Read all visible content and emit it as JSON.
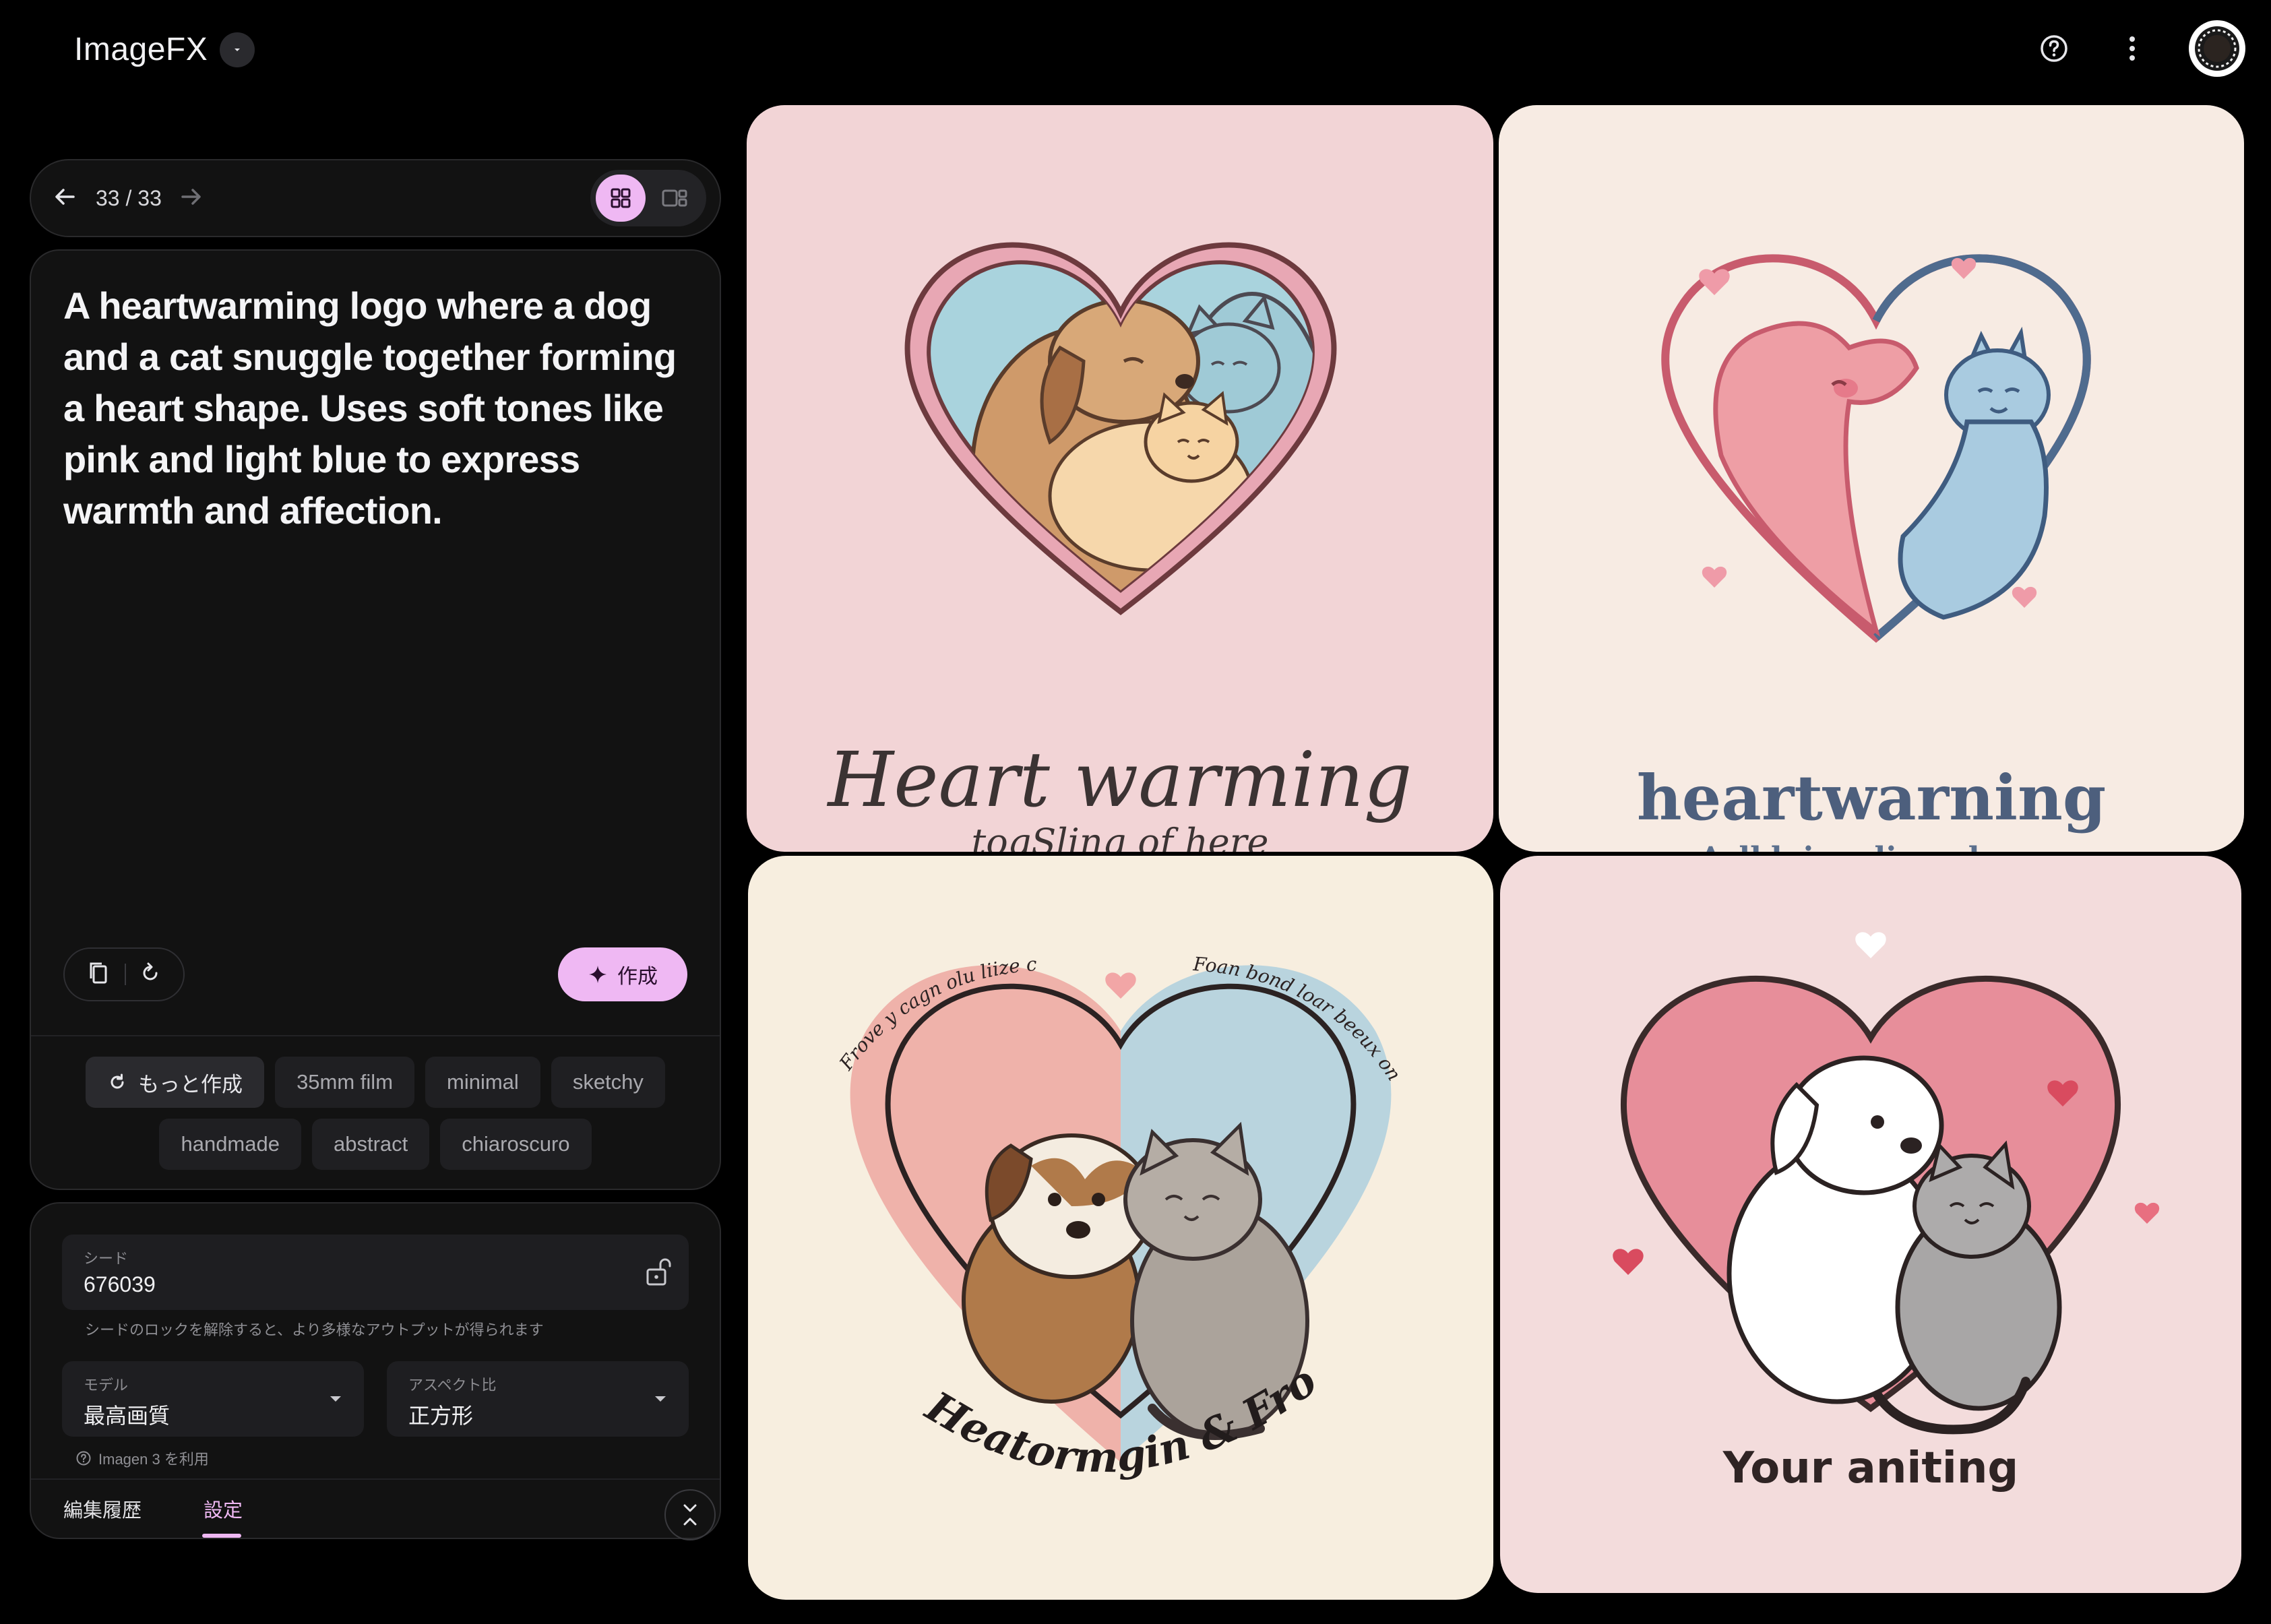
{
  "app": {
    "name": "ImageFX"
  },
  "header": {
    "icons": [
      "help-icon",
      "more-vert-icon",
      "account-avatar"
    ]
  },
  "navigation": {
    "counter": "33 / 33",
    "view_modes": [
      "grid",
      "single"
    ],
    "active_view": "grid"
  },
  "prompt": {
    "text": "A heartwarming logo where a dog and a cat snuggle together forming a heart shape. Uses soft tones like pink and light blue to express warmth and affection.",
    "create_label": "作成"
  },
  "chips": {
    "more_label": "もっと作成",
    "items": [
      "35mm film",
      "minimal",
      "sketchy",
      "handmade",
      "abstract",
      "chiaroscuro"
    ]
  },
  "settings": {
    "seed": {
      "label": "シード",
      "value": "676039",
      "hint": "シードのロックを解除すると、より多様なアウトプットが得られます"
    },
    "model": {
      "label": "モデル",
      "value": "最高画質",
      "note": "Imagen 3 を利用"
    },
    "aspect": {
      "label": "アスペクト比",
      "value": "正方形"
    },
    "tabs": {
      "history": "編集履歴",
      "settings": "設定"
    }
  },
  "images": [
    {
      "title": "Heart warming",
      "subtitle": "togSling of here"
    },
    {
      "title": "heartwarning",
      "subtitle": "Aslldgine digen hare"
    },
    {
      "top_left_arc": "Frove y cagn olu liize cogre",
      "top_right_arc": "Foan bond loar beeux oninet",
      "bottom_arc": "Heatormgin & Fronds logot"
    },
    {
      "title": "Your aniting"
    }
  ],
  "colors": {
    "accent": "#efb8f3",
    "background": "#000000",
    "panel": "#121212"
  }
}
